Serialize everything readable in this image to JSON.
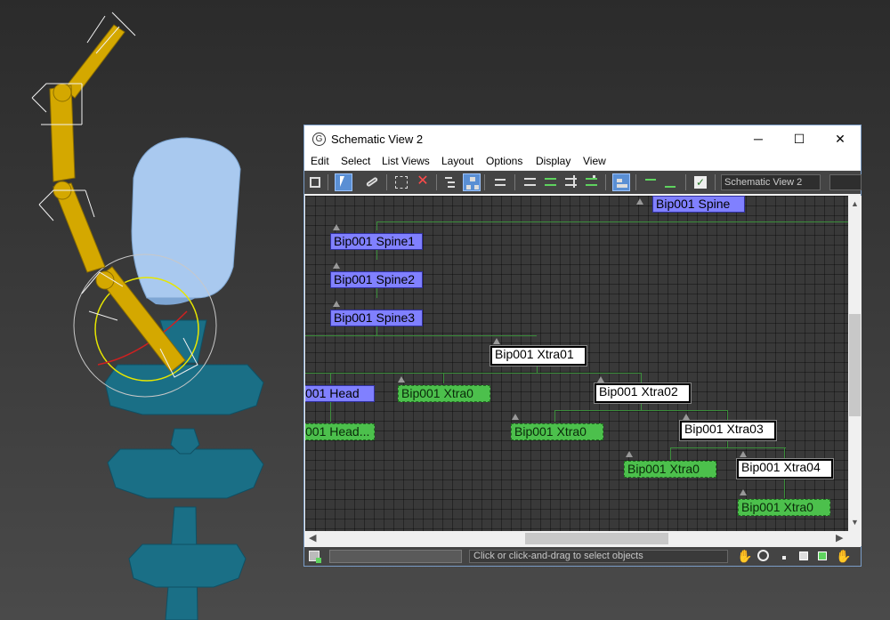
{
  "window": {
    "title": "Schematic View 2",
    "controls": {
      "minimize": "─",
      "maximize": "☐",
      "close": "✕"
    }
  },
  "menu": [
    "Edit",
    "Select",
    "List Views",
    "Layout",
    "Options",
    "Display",
    "View"
  ],
  "toolbar": {
    "view_name": "Schematic View 2"
  },
  "status": {
    "prompt": "Click or click-and-drag to select objects"
  },
  "nodes": [
    {
      "label": "Bip001 Spine",
      "style": "blue"
    },
    {
      "label": "Bip001 Spine1",
      "style": "blue"
    },
    {
      "label": "Bip001 Spine2",
      "style": "blue"
    },
    {
      "label": "Bip001 Spine3",
      "style": "blue"
    },
    {
      "label": "Bip001 Xtra01",
      "style": "white"
    },
    {
      "label": "001 Head",
      "style": "blue"
    },
    {
      "label": "Bip001 Xtra0",
      "style": "green"
    },
    {
      "label": "Bip001 Xtra02",
      "style": "white"
    },
    {
      "label": "001 Head...",
      "style": "green"
    },
    {
      "label": "Bip001 Xtra0",
      "style": "green"
    },
    {
      "label": "Bip001 Xtra03",
      "style": "white"
    },
    {
      "label": "Bip001 Xtra0",
      "style": "green"
    },
    {
      "label": "Bip001 Xtra04",
      "style": "white"
    },
    {
      "label": "Bip001 Xtra0",
      "style": "green"
    }
  ],
  "colors": {
    "node_blue": "#8080ff",
    "node_green": "#4cc04c",
    "bone_gold": "#d4a800",
    "mesh_teal": "#1a6f86",
    "mesh_head": "#a9c9ef"
  }
}
